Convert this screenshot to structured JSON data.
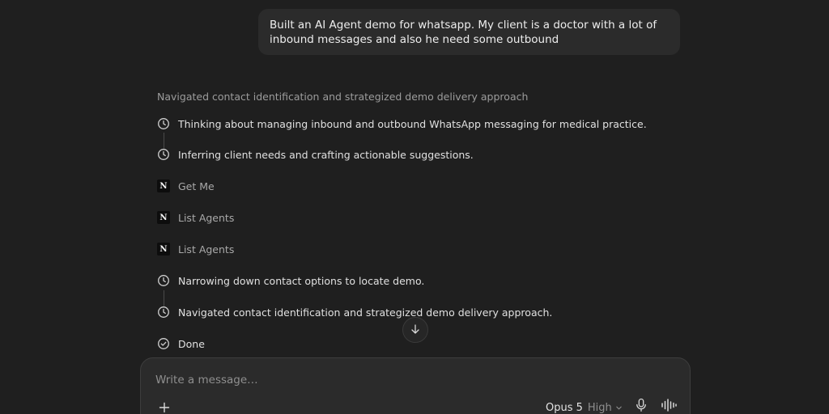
{
  "user_message": "Built an AI Agent demo for whatsapp. My client is a doctor with a lot of inbound messages and also he need some outbound",
  "activity": {
    "summary": "Navigated contact identification and strategized demo delivery approach",
    "steps": [
      {
        "icon": "clock-icon",
        "text": "Thinking about managing inbound and outbound WhatsApp messaging for medical practice."
      },
      {
        "icon": "clock-icon",
        "text": "Inferring client needs and crafting actionable suggestions."
      },
      {
        "icon": "n-app-icon",
        "text": "Get Me"
      },
      {
        "icon": "n-app-icon",
        "text": "List Agents"
      },
      {
        "icon": "n-app-icon",
        "text": "List Agents"
      },
      {
        "icon": "clock-icon",
        "text": "Narrowing down contact options to locate demo."
      },
      {
        "icon": "clock-icon",
        "text": "Navigated contact identification and strategized demo delivery approach."
      },
      {
        "icon": "check-circle-icon",
        "text": "Done"
      }
    ],
    "app_glyph": "N"
  },
  "composer": {
    "placeholder": "Write a message…",
    "model": "Opus 5",
    "effort": "High"
  },
  "icons": {
    "scroll": "arrow-down-icon",
    "attach": "plus-icon",
    "model_menu": "chevron-down-icon",
    "dictate": "microphone-icon",
    "voice": "waveform-icon"
  }
}
